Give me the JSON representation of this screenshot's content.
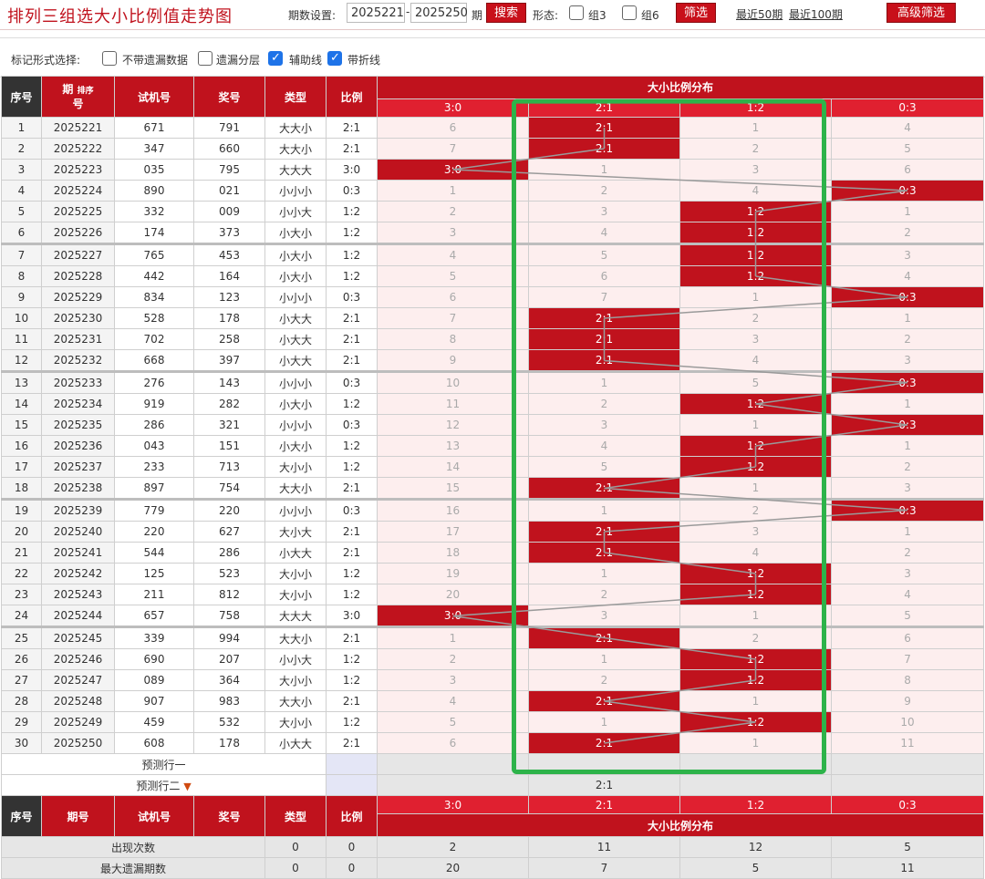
{
  "header": {
    "title": "排列三组选大小比例值走势图",
    "period_label": "期数设置:",
    "start_period": "2025221",
    "end_period": "2025250",
    "period_suffix": "期",
    "search_label": "搜索",
    "shape_label": "形态:",
    "group3_label": "组3",
    "group6_label": "组6",
    "filter_label": "筛选",
    "recent50": "最近50期",
    "recent100": "最近100期",
    "advanced_filter": "高级筛选"
  },
  "options": {
    "label": "标记形式选择:",
    "items": [
      {
        "label": "不带遗漏数据",
        "checked": false
      },
      {
        "label": "遗漏分层",
        "checked": false
      },
      {
        "label": "辅助线",
        "checked": true
      },
      {
        "label": "带折线",
        "checked": true
      }
    ]
  },
  "table": {
    "headers": {
      "seq": "序号",
      "period": "期号",
      "period_top": "期",
      "period_bottom": "号",
      "sort_label": "排序",
      "test": "试机号",
      "draw": "奖号",
      "type": "类型",
      "ratio": "比例",
      "dist": "大小比例分布"
    },
    "dist_columns": [
      "3:0",
      "2:1",
      "1:2",
      "0:3"
    ],
    "rows": [
      {
        "seq": "1",
        "period": "2025221",
        "test": "671",
        "draw": "791",
        "type": "大大小",
        "ratio": "2:1",
        "dist": [
          "6",
          "2:1",
          "1",
          "4"
        ]
      },
      {
        "seq": "2",
        "period": "2025222",
        "test": "347",
        "draw": "660",
        "type": "大大小",
        "ratio": "2:1",
        "dist": [
          "7",
          "2:1",
          "2",
          "5"
        ]
      },
      {
        "seq": "3",
        "period": "2025223",
        "test": "035",
        "draw": "795",
        "type": "大大大",
        "ratio": "3:0",
        "dist": [
          "3:0",
          "1",
          "3",
          "6"
        ]
      },
      {
        "seq": "4",
        "period": "2025224",
        "test": "890",
        "draw": "021",
        "type": "小小小",
        "ratio": "0:3",
        "dist": [
          "1",
          "2",
          "4",
          "0:3"
        ]
      },
      {
        "seq": "5",
        "period": "2025225",
        "test": "332",
        "draw": "009",
        "type": "小小大",
        "ratio": "1:2",
        "dist": [
          "2",
          "3",
          "1:2",
          "1"
        ]
      },
      {
        "seq": "6",
        "period": "2025226",
        "test": "174",
        "draw": "373",
        "type": "小大小",
        "ratio": "1:2",
        "dist": [
          "3",
          "4",
          "1:2",
          "2"
        ]
      },
      {
        "seq": "7",
        "period": "2025227",
        "test": "765",
        "draw": "453",
        "type": "小大小",
        "ratio": "1:2",
        "dist": [
          "4",
          "5",
          "1:2",
          "3"
        ]
      },
      {
        "seq": "8",
        "period": "2025228",
        "test": "442",
        "draw": "164",
        "type": "小大小",
        "ratio": "1:2",
        "dist": [
          "5",
          "6",
          "1:2",
          "4"
        ]
      },
      {
        "seq": "9",
        "period": "2025229",
        "test": "834",
        "draw": "123",
        "type": "小小小",
        "ratio": "0:3",
        "dist": [
          "6",
          "7",
          "1",
          "0:3"
        ]
      },
      {
        "seq": "10",
        "period": "2025230",
        "test": "528",
        "draw": "178",
        "type": "小大大",
        "ratio": "2:1",
        "dist": [
          "7",
          "2:1",
          "2",
          "1"
        ]
      },
      {
        "seq": "11",
        "period": "2025231",
        "test": "702",
        "draw": "258",
        "type": "小大大",
        "ratio": "2:1",
        "dist": [
          "8",
          "2:1",
          "3",
          "2"
        ]
      },
      {
        "seq": "12",
        "period": "2025232",
        "test": "668",
        "draw": "397",
        "type": "小大大",
        "ratio": "2:1",
        "dist": [
          "9",
          "2:1",
          "4",
          "3"
        ]
      },
      {
        "seq": "13",
        "period": "2025233",
        "test": "276",
        "draw": "143",
        "type": "小小小",
        "ratio": "0:3",
        "dist": [
          "10",
          "1",
          "5",
          "0:3"
        ]
      },
      {
        "seq": "14",
        "period": "2025234",
        "test": "919",
        "draw": "282",
        "type": "小大小",
        "ratio": "1:2",
        "dist": [
          "11",
          "2",
          "1:2",
          "1"
        ]
      },
      {
        "seq": "15",
        "period": "2025235",
        "test": "286",
        "draw": "321",
        "type": "小小小",
        "ratio": "0:3",
        "dist": [
          "12",
          "3",
          "1",
          "0:3"
        ]
      },
      {
        "seq": "16",
        "period": "2025236",
        "test": "043",
        "draw": "151",
        "type": "小大小",
        "ratio": "1:2",
        "dist": [
          "13",
          "4",
          "1:2",
          "1"
        ]
      },
      {
        "seq": "17",
        "period": "2025237",
        "test": "233",
        "draw": "713",
        "type": "大小小",
        "ratio": "1:2",
        "dist": [
          "14",
          "5",
          "1:2",
          "2"
        ]
      },
      {
        "seq": "18",
        "period": "2025238",
        "test": "897",
        "draw": "754",
        "type": "大大小",
        "ratio": "2:1",
        "dist": [
          "15",
          "2:1",
          "1",
          "3"
        ]
      },
      {
        "seq": "19",
        "period": "2025239",
        "test": "779",
        "draw": "220",
        "type": "小小小",
        "ratio": "0:3",
        "dist": [
          "16",
          "1",
          "2",
          "0:3"
        ]
      },
      {
        "seq": "20",
        "period": "2025240",
        "test": "220",
        "draw": "627",
        "type": "大小大",
        "ratio": "2:1",
        "dist": [
          "17",
          "2:1",
          "3",
          "1"
        ]
      },
      {
        "seq": "21",
        "period": "2025241",
        "test": "544",
        "draw": "286",
        "type": "小大大",
        "ratio": "2:1",
        "dist": [
          "18",
          "2:1",
          "4",
          "2"
        ]
      },
      {
        "seq": "22",
        "period": "2025242",
        "test": "125",
        "draw": "523",
        "type": "大小小",
        "ratio": "1:2",
        "dist": [
          "19",
          "1",
          "1:2",
          "3"
        ]
      },
      {
        "seq": "23",
        "period": "2025243",
        "test": "211",
        "draw": "812",
        "type": "大小小",
        "ratio": "1:2",
        "dist": [
          "20",
          "2",
          "1:2",
          "4"
        ]
      },
      {
        "seq": "24",
        "period": "2025244",
        "test": "657",
        "draw": "758",
        "type": "大大大",
        "ratio": "3:0",
        "dist": [
          "3:0",
          "3",
          "1",
          "5"
        ]
      },
      {
        "seq": "25",
        "period": "2025245",
        "test": "339",
        "draw": "994",
        "type": "大大小",
        "ratio": "2:1",
        "dist": [
          "1",
          "2:1",
          "2",
          "6"
        ]
      },
      {
        "seq": "26",
        "period": "2025246",
        "test": "690",
        "draw": "207",
        "type": "小小大",
        "ratio": "1:2",
        "dist": [
          "2",
          "1",
          "1:2",
          "7"
        ]
      },
      {
        "seq": "27",
        "period": "2025247",
        "test": "089",
        "draw": "364",
        "type": "大小小",
        "ratio": "1:2",
        "dist": [
          "3",
          "2",
          "1:2",
          "8"
        ]
      },
      {
        "seq": "28",
        "period": "2025248",
        "test": "907",
        "draw": "983",
        "type": "大大小",
        "ratio": "2:1",
        "dist": [
          "4",
          "2:1",
          "1",
          "9"
        ]
      },
      {
        "seq": "29",
        "period": "2025249",
        "test": "459",
        "draw": "532",
        "type": "大小小",
        "ratio": "1:2",
        "dist": [
          "5",
          "1",
          "1:2",
          "10"
        ]
      },
      {
        "seq": "30",
        "period": "2025250",
        "test": "608",
        "draw": "178",
        "type": "小大大",
        "ratio": "2:1",
        "dist": [
          "6",
          "2:1",
          "1",
          "11"
        ]
      }
    ],
    "hit_index": [
      1,
      1,
      0,
      3,
      2,
      2,
      2,
      2,
      3,
      1,
      1,
      1,
      3,
      2,
      3,
      2,
      2,
      1,
      3,
      1,
      1,
      2,
      2,
      0,
      1,
      2,
      2,
      1,
      2,
      1
    ],
    "predict": {
      "row1": "预测行一",
      "row2": "预测行二",
      "row2_value": "2:1"
    },
    "stats": [
      {
        "label": "出现次数",
        "type": "0",
        "ratio": "0",
        "dist": [
          "2",
          "11",
          "12",
          "5"
        ]
      },
      {
        "label": "最大遗漏期数",
        "type": "0",
        "ratio": "0",
        "dist": [
          "20",
          "7",
          "5",
          "11"
        ]
      }
    ]
  },
  "colors": {
    "brand_red": "#c0121d",
    "highlight_green": "#2db34a"
  }
}
